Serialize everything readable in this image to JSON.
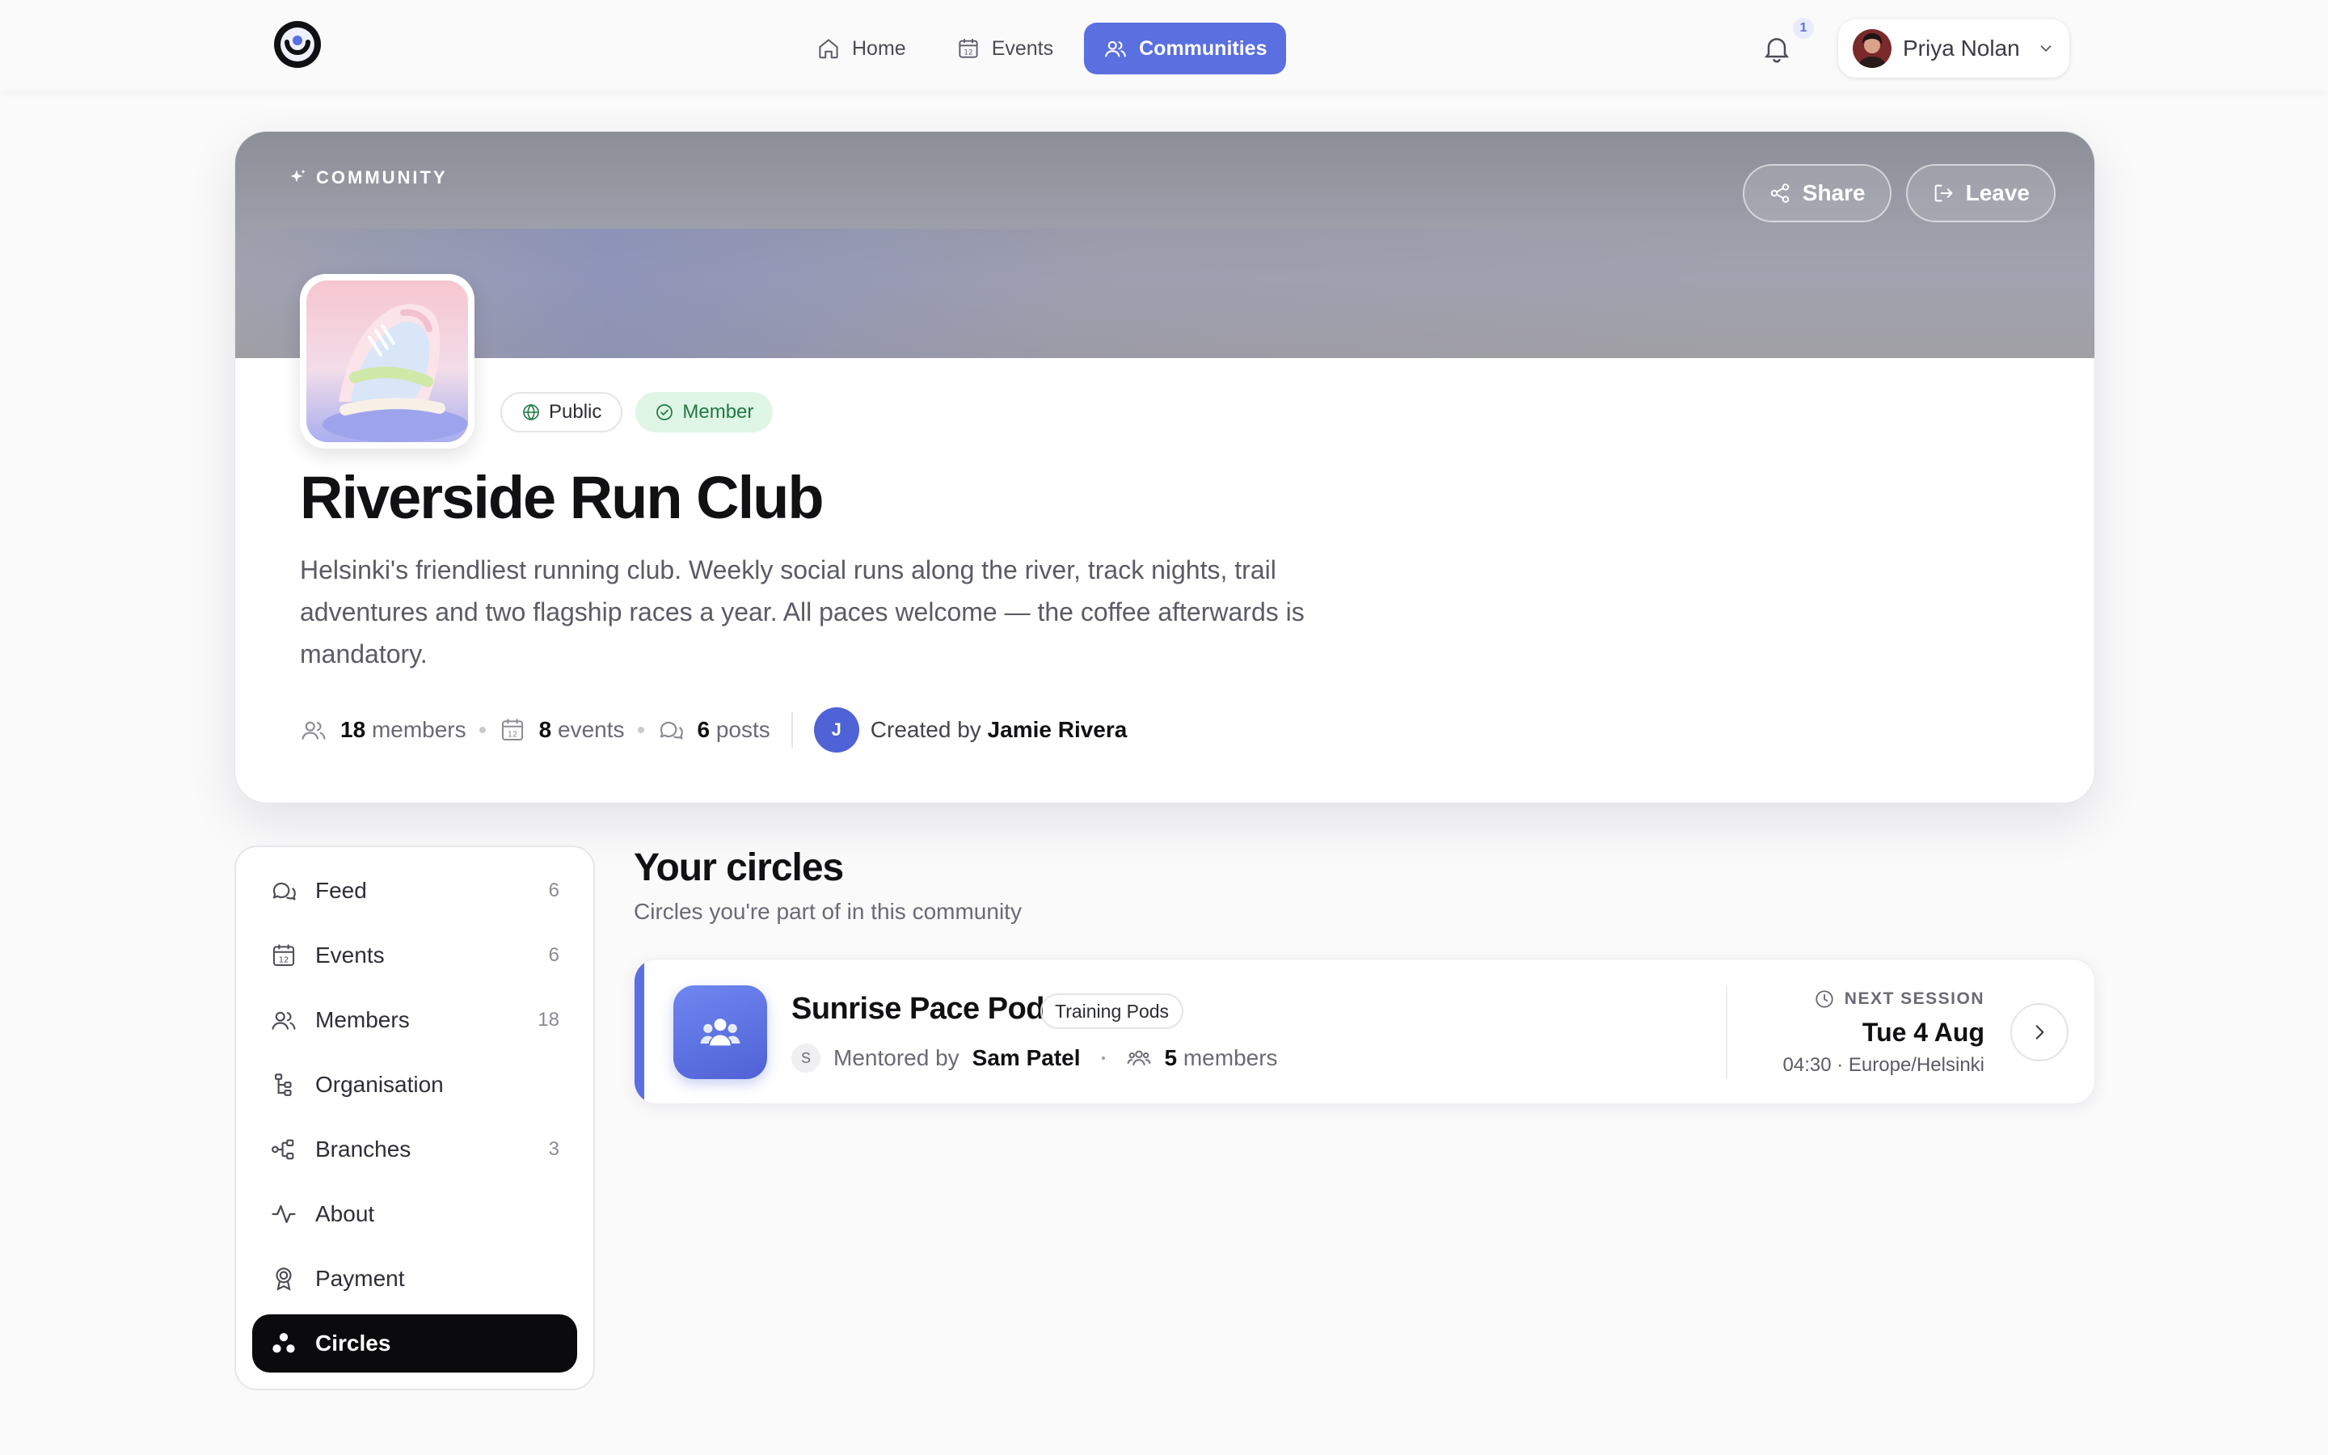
{
  "nav": {
    "links": [
      {
        "label": "Home",
        "icon": "home-icon",
        "active": false
      },
      {
        "label": "Events",
        "icon": "calendar-icon",
        "active": false
      },
      {
        "label": "Communities",
        "icon": "users-icon",
        "active": true
      }
    ],
    "notifications_count": "1",
    "user_name": "Priya Nolan"
  },
  "hero": {
    "eyebrow": "COMMUNITY",
    "share_label": "Share",
    "leave_label": "Leave",
    "chips": {
      "public": "Public",
      "member": "Member"
    },
    "title": "Riverside Run Club",
    "description": "Helsinki's friendliest running club. Weekly social runs along the river, track nights, trail adventures and two flagship races a year. All paces welcome — the coffee afterwards is mandatory.",
    "stats": {
      "members_count": "18",
      "members_label": "members",
      "events_count": "8",
      "events_label": "events",
      "posts_count": "6",
      "posts_label": "posts"
    },
    "creator_initial": "J",
    "created_by_prefix": "Created by",
    "created_by_name": "Jamie Rivera"
  },
  "sidebar": {
    "items": [
      {
        "label": "Feed",
        "count": "6",
        "icon": "chat-icon"
      },
      {
        "label": "Events",
        "count": "6",
        "icon": "calendar-icon"
      },
      {
        "label": "Members",
        "count": "18",
        "icon": "users-icon"
      },
      {
        "label": "Organisation",
        "count": "",
        "icon": "hierarchy-icon"
      },
      {
        "label": "Branches",
        "count": "3",
        "icon": "branches-icon"
      },
      {
        "label": "About",
        "count": "",
        "icon": "activity-icon"
      },
      {
        "label": "Payment",
        "count": "",
        "icon": "award-icon"
      },
      {
        "label": "Circles",
        "count": "",
        "icon": "circles-icon",
        "active": true
      }
    ]
  },
  "circles": {
    "title": "Your circles",
    "subtitle": "Circles you're part of in this community",
    "items": [
      {
        "name": "Sunrise Pace Pod",
        "tag": "Training Pods",
        "mentor_initial": "S",
        "mentored_by_label": "Mentored by",
        "mentor_name": "Sam Patel",
        "members_count": "5",
        "members_label": "members",
        "next_label": "NEXT SESSION",
        "next_date": "Tue 4 Aug",
        "next_time": "04:30 · Europe/Helsinki"
      }
    ]
  },
  "colors": {
    "accent": "#5a6fe0",
    "member_chip_bg": "#dff5e6",
    "active_nav_item": "#0b0b0d"
  }
}
